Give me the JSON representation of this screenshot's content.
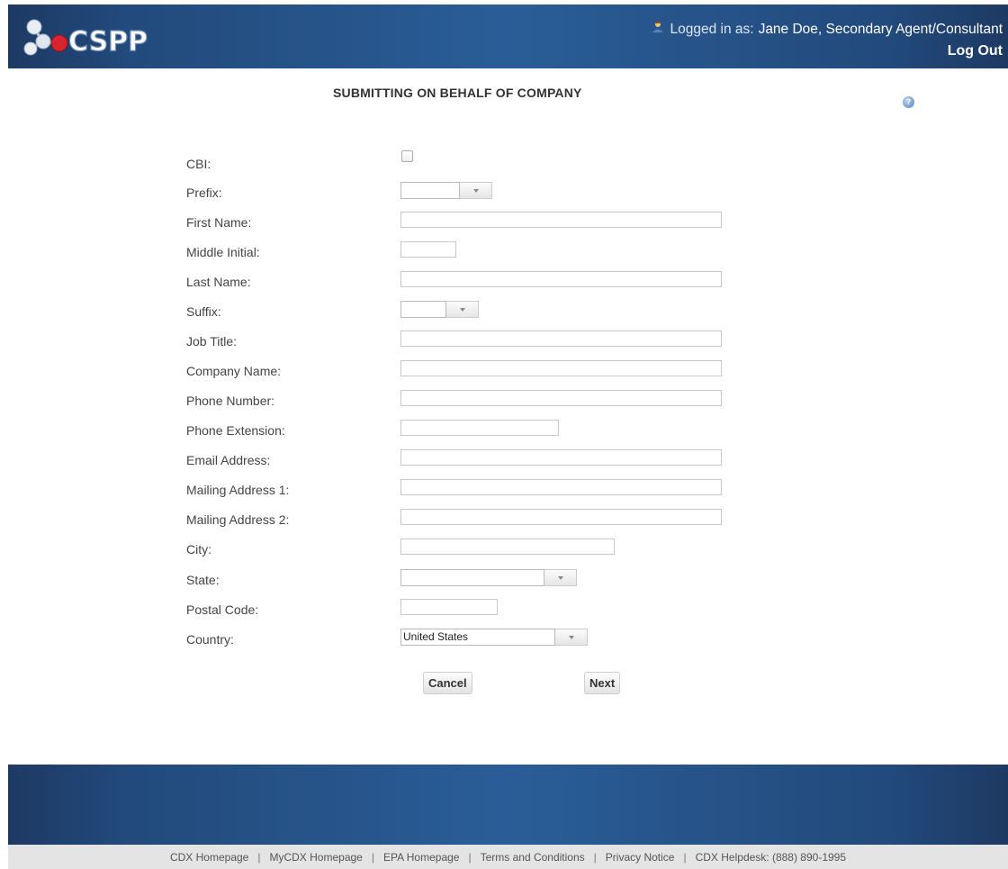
{
  "header": {
    "logo_text": "CSPP",
    "logged_in_prefix": "Logged in as:",
    "user_name": "Jane Doe, Secondary Agent/Consultant",
    "logout_label": "Log Out"
  },
  "page": {
    "title": "SUBMITTING ON BEHALF OF COMPANY"
  },
  "form": {
    "cbi_label": "CBI:",
    "prefix_label": "Prefix:",
    "prefix_value": "",
    "first_name_label": "First Name:",
    "middle_initial_label": "Middle Initial:",
    "last_name_label": "Last Name:",
    "suffix_label": "Suffix:",
    "suffix_value": "",
    "job_title_label": "Job Title:",
    "company_name_label": "Company Name:",
    "phone_number_label": "Phone Number:",
    "phone_extension_label": "Phone Extension:",
    "email_label": "Email Address:",
    "mailing1_label": "Mailing Address 1:",
    "mailing2_label": "Mailing Address 2:",
    "city_label": "City:",
    "state_label": "State:",
    "state_value": "",
    "postal_code_label": "Postal Code:",
    "country_label": "Country:",
    "country_value": "United States"
  },
  "buttons": {
    "cancel_label": "Cancel",
    "next_label": "Next"
  },
  "footer": {
    "links": [
      "CDX Homepage",
      "MyCDX Homepage",
      "EPA Homepage",
      "Terms and Conditions",
      "Privacy Notice",
      "CDX Helpdesk: (888) 890-1995"
    ]
  }
}
